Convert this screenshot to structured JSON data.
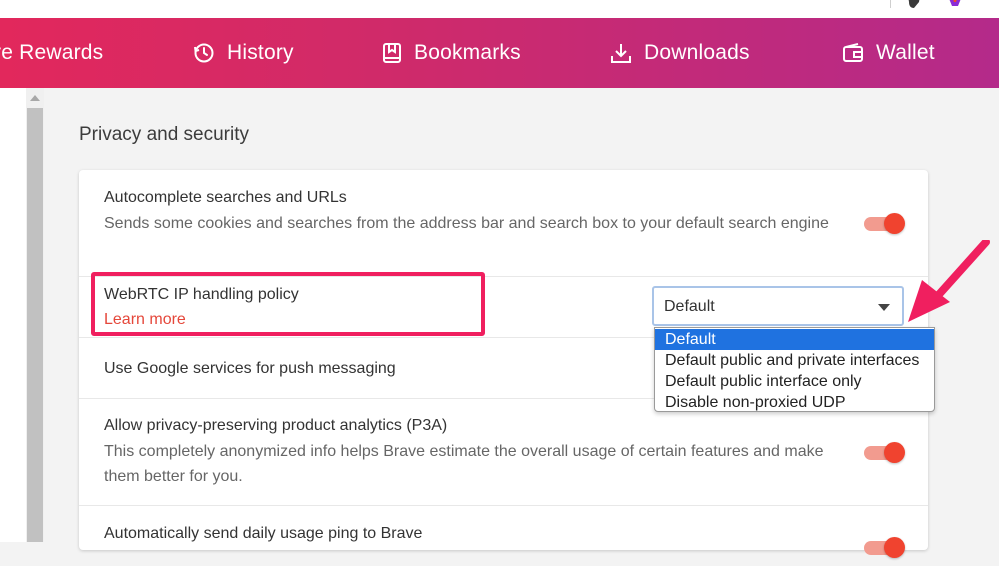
{
  "nav": {
    "items": [
      {
        "label": "re Rewards",
        "icon": "rewards-icon"
      },
      {
        "label": "History",
        "icon": "history-icon"
      },
      {
        "label": "Bookmarks",
        "icon": "bookmark-icon"
      },
      {
        "label": "Downloads",
        "icon": "download-icon"
      },
      {
        "label": "Wallet",
        "icon": "wallet-icon"
      }
    ]
  },
  "section": {
    "title": "Privacy and security"
  },
  "settings": {
    "autocomplete": {
      "title": "Autocomplete searches and URLs",
      "desc": "Sends some cookies and searches from the address bar and search box to your default search engine",
      "enabled": true
    },
    "webrtc": {
      "title": "WebRTC IP handling policy",
      "learn_more": "Learn more",
      "selected": "Default",
      "options": [
        "Default",
        "Default public and private interfaces",
        "Default public interface only",
        "Disable non-proxied UDP"
      ]
    },
    "push": {
      "title": "Use Google services for push messaging"
    },
    "p3a": {
      "title": "Allow privacy-preserving product analytics (P3A)",
      "desc": "This completely anonymized info helps Brave estimate the overall usage of certain features and make them better for you.",
      "enabled": true
    },
    "usage_ping": {
      "title": "Automatically send daily usage ping to Brave",
      "enabled": true
    }
  },
  "colors": {
    "nav_gradient_start": "#e2285c",
    "nav_gradient_end": "#b42a8a",
    "accent": "#f0432f",
    "link": "#e5473a",
    "highlight": "#f01f5f",
    "option_selected": "#1f72e0"
  }
}
